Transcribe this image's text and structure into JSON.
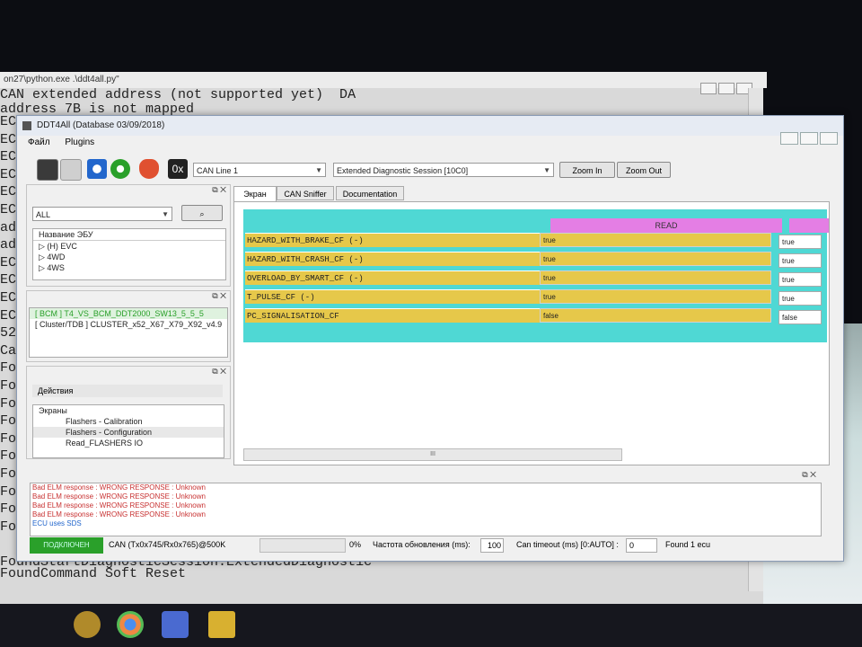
{
  "console": {
    "title": "on27\\python.exe  .\\ddt4all.py\"",
    "lines_top": [
      "CAN extended address (not supported yet)  DA",
      "address 7B is not mapped"
    ],
    "left_fragments": [
      "ECU",
      "ECU",
      "ECU",
      "ECU",
      "ECU",
      "ECU",
      "ado",
      "ado",
      "ECU",
      "ECU",
      "ECU",
      "ECU",
      "52",
      "Can",
      "Foun",
      "Foun",
      "Foun",
      "Foun",
      "Foun",
      "Foun",
      "Foun",
      "Foun",
      "Foun",
      "Foun"
    ],
    "lines_bottom": [
      "FoundStartDiagnosticSession.ExtendedDiagnostic",
      "FoundCommand Soft Reset"
    ]
  },
  "window": {
    "title": "DDT4All (Database 03/09/2018)",
    "menu": [
      "Файл",
      "Plugins"
    ]
  },
  "toolbar": {
    "hex_label": "0x",
    "can_line": "CAN Line 1",
    "session": "Extended Diagnostic Session [10C0]",
    "zoom_in": "Zoom In",
    "zoom_out": "Zoom Out"
  },
  "left_panel": {
    "filter": "ALL",
    "tree_header": "Название ЭБУ",
    "tree_items": [
      "(H) EVC",
      "4WD",
      "4WS"
    ],
    "ecu_selected": "[ BCM ] T4_VS_BCM_DDT2000_SW13_5_5_5",
    "ecu_other": "[ Cluster/TDB ] CLUSTER_x52_X67_X79_X92_v4.9",
    "actions_label": "Действия",
    "screens_label": "Экраны",
    "screens": [
      "Flashers - Calibration",
      "Flashers - Configuration",
      "Read_FLASHERS IO"
    ]
  },
  "tabs": [
    "Экран",
    "CAN Sniffer",
    "Documentation"
  ],
  "screen": {
    "read_header": "READ",
    "rows": [
      {
        "label": "HAZARD_WITH_BRAKE_CF (-)",
        "value": "true",
        "value2": "true"
      },
      {
        "label": "HAZARD_WITH_CRASH_CF (-)",
        "value": "true",
        "value2": "true"
      },
      {
        "label": "OVERLOAD_BY_SMART_CF (-)",
        "value": "true",
        "value2": "true"
      },
      {
        "label": "T_PULSE_CF (-)",
        "value": "true",
        "value2": "true"
      },
      {
        "label": "PC_SIGNALISATION_CF",
        "value": "false",
        "value2": "false"
      }
    ],
    "scroll_mark": "III"
  },
  "log": {
    "lines": [
      "Bad ELM response : WRONG RESPONSE : Unknown",
      "Bad ELM response : WRONG RESPONSE : Unknown",
      "Bad ELM response : WRONG RESPONSE : Unknown",
      "Bad ELM response : WRONG RESPONSE : Unknown",
      "ECU uses SDS"
    ]
  },
  "status": {
    "connection": "ПОДКЛЮЧЕН",
    "can_info": "CAN (Tx0x745/Rx0x765)@500K",
    "progress": "0%",
    "refresh_label": "Частота обновления (ms):",
    "refresh_value": "100",
    "timeout_label": "Can timeout (ms) [0:AUTO] :",
    "timeout_value": "0",
    "found": "Found 1 ecu"
  },
  "colors": {
    "cyan": "#4fd8d4",
    "yellow": "#e6c84a",
    "pink": "#e47ee4",
    "connected": "#2aa02a",
    "error_text": "#c83232"
  }
}
